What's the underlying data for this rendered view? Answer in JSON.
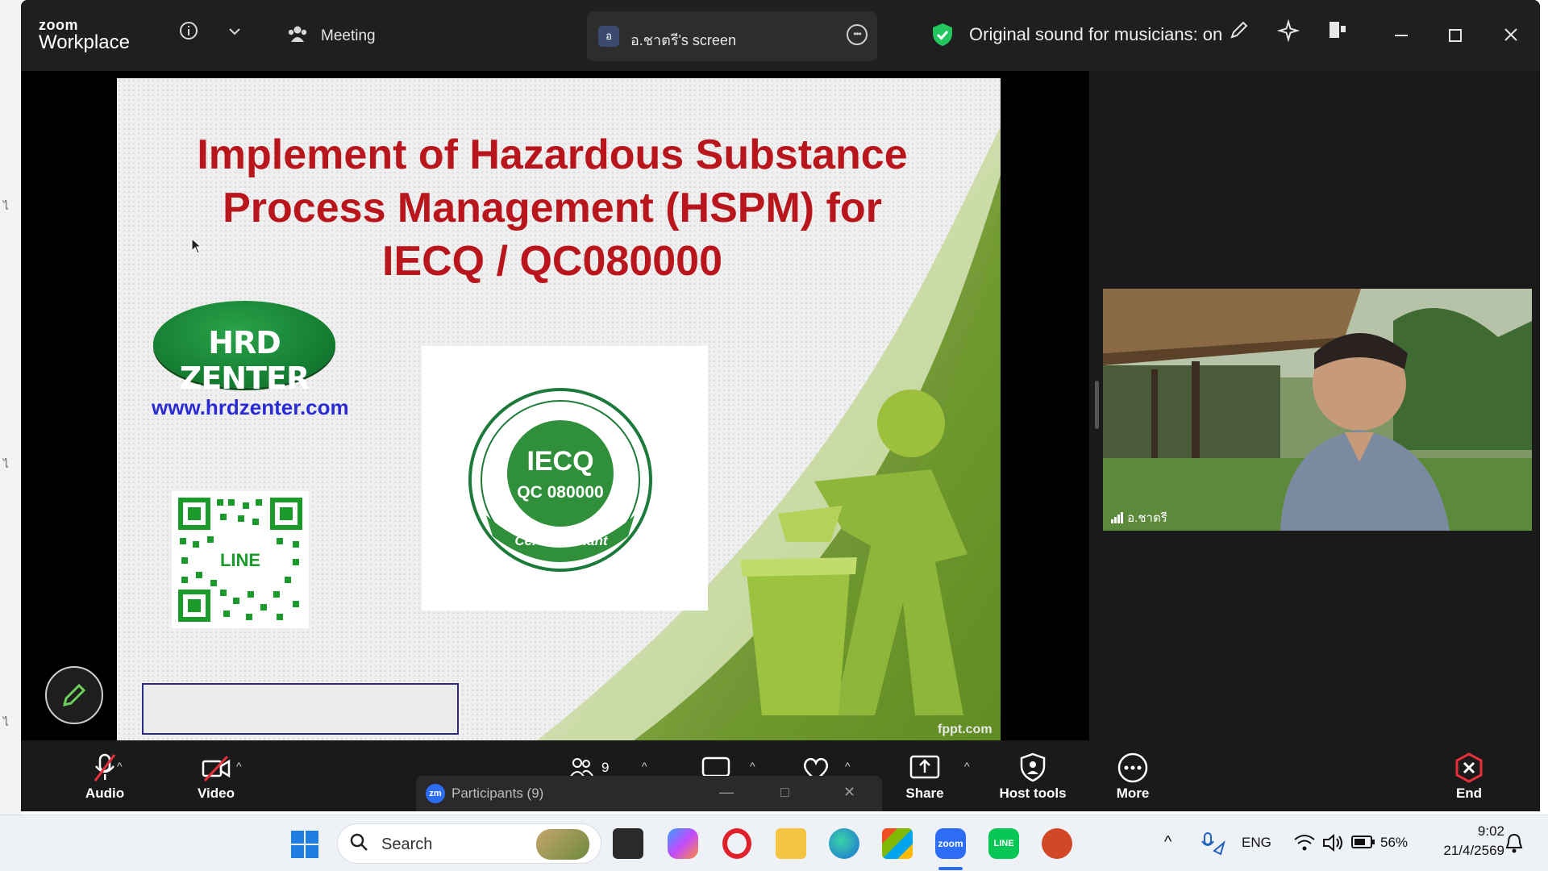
{
  "window": {
    "logo_line1": "zoom",
    "logo_line2": "Workplace",
    "meeting_label": "Meeting",
    "share_tab_avatar": "อ",
    "share_tab_label": "อ.ชาตรี's screen",
    "original_sound": "Original sound for musicians: on"
  },
  "slide": {
    "title_line1": "Implement of Hazardous Substance",
    "title_line2": "Process Management (HSPM) for",
    "title_line3": "IECQ / QC080000",
    "logo_text": "HRD ZENTER",
    "url": "www.hrdzenter.com",
    "qr_label": "LINE",
    "cert_center_top": "IECQ",
    "cert_center_bottom": "QC 080000",
    "cert_ring_text": "Manufactured by IECQ QC 080000 Certified Plant",
    "cert_bottom_text": "Certified Plant",
    "footer_credit": "fppt.com"
  },
  "video": {
    "participant_name": "อ.ชาตรี"
  },
  "toolbar": {
    "audio": "Audio",
    "video": "Video",
    "participants_count": "9",
    "share": "Share",
    "host_tools": "Host tools",
    "more": "More",
    "end": "End",
    "participants_panel": "Participants (9)"
  },
  "taskbar": {
    "search_placeholder": "Search",
    "lang": "ENG",
    "battery": "56%",
    "time": "9:02",
    "date": "21/4/2569"
  },
  "colors": {
    "slide_title": "#b8161c",
    "url_blue": "#2b2bd6",
    "shield_green": "#22c55e",
    "end_red": "#e5303b"
  }
}
